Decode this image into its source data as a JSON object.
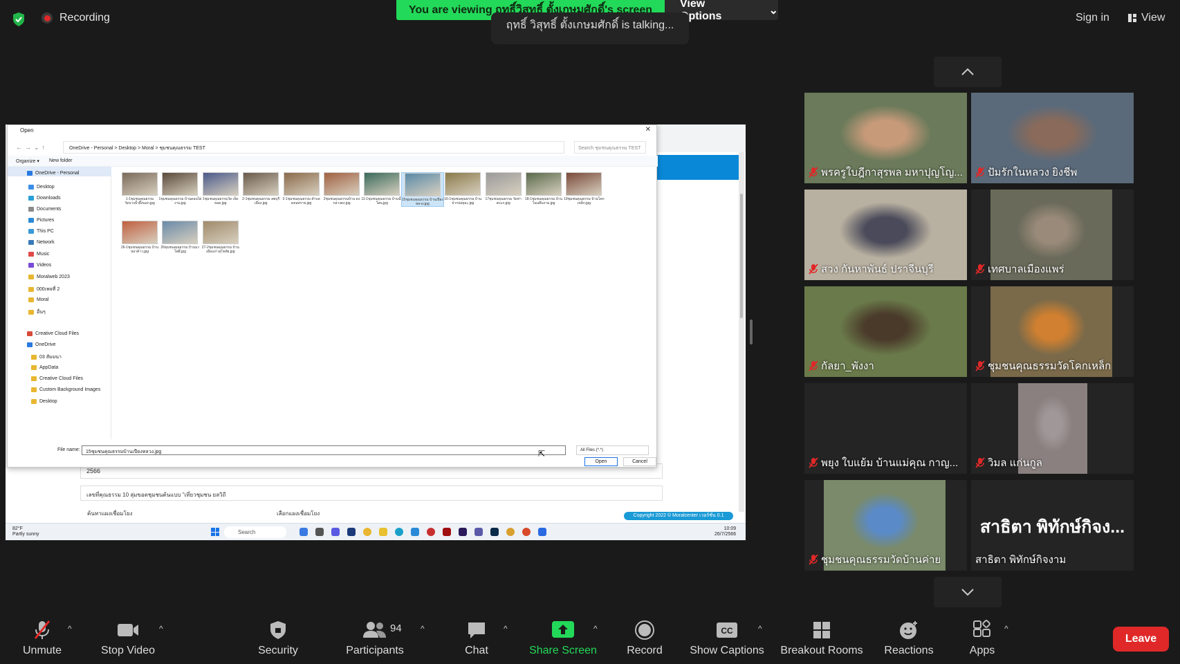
{
  "top": {
    "recording": "Recording",
    "viewing_banner": "You are viewing ฤทธิ์วิสุทธิ์ ตั้งเกษมศักดิ์'s screen",
    "view_options": "View Options",
    "talking": "ฤทธิ์ วิสุทธิ์ ตั้งเกษมศักดิ์ is talking...",
    "sign_in": "Sign in",
    "view": "View"
  },
  "dialog": {
    "title": "Open",
    "path": "OneDrive - Personal  >  Desktop  >  Moral  >  ชุมชนคุณธรรม TEST",
    "search_placeholder": "Search ชุมชนคุณธรรม TEST",
    "organize": "Organize ▾",
    "new_folder": "New folder",
    "nav": [
      {
        "label": "OneDrive - Personal",
        "color": "#2a7ae2"
      },
      {
        "label": "Desktop",
        "color": "#3a8ee6"
      },
      {
        "label": "Downloads",
        "color": "#2aa0d8"
      },
      {
        "label": "Documents",
        "color": "#8a8a8a"
      },
      {
        "label": "Pictures",
        "color": "#2a8ad8"
      },
      {
        "label": "This PC",
        "color": "#3a9ad8"
      },
      {
        "label": "Network",
        "color": "#3a7ab8"
      },
      {
        "label": "Music",
        "color": "#e04a4a"
      },
      {
        "label": "Videos",
        "color": "#7a4ad8"
      },
      {
        "label": "Moralweb 2023",
        "color": "#e8b630"
      },
      {
        "label": "000เพจที่ 2",
        "color": "#e8b630"
      },
      {
        "label": "Moral",
        "color": "#e8b630"
      },
      {
        "label": "อื่นๆ",
        "color": "#e8b630"
      },
      {
        "label": "Creative Cloud Files",
        "color": "#d84a3a"
      },
      {
        "label": "OneDrive",
        "color": "#2a7ae2"
      },
      {
        "label": "03 สัมมนา",
        "color": "#e8b630"
      },
      {
        "label": "AppData",
        "color": "#e8b630"
      },
      {
        "label": "Creative Cloud Files",
        "color": "#e8b630"
      },
      {
        "label": "Custom Background Images",
        "color": "#e8b630"
      },
      {
        "label": "Desktop",
        "color": "#e8b630"
      }
    ],
    "files": [
      {
        "caption": "1-1ชุมชนคุณธรรม วัดบางน้ำผึ้งนอก.jpg",
        "color": "#7a6a5a"
      },
      {
        "caption": "1ชุมชนคุณธรรม บ้านดอนไผ่งาม.jpg",
        "color": "#5a4a3a"
      },
      {
        "caption": "1ชุมชนคุณธรรมวัด เจ็ดยอด.jpg",
        "color": "#4a5a8a"
      },
      {
        "caption": "2-1ชุมชนคุณธรรม ลพบุรีเมือง.jpg",
        "color": "#6a5a4a"
      },
      {
        "caption": "2-1ชุมชนคุณธรรม ตำบลดอนทราย.jpg",
        "color": "#8a6a4a"
      },
      {
        "caption": "2ชุมชนคุณธรรมบ้าน ดงกลางดง.jpg",
        "color": "#a06040"
      },
      {
        "caption": "11-1ชุมชนคุณธรรม บ้านน้ำใสน.jpg",
        "color": "#3a6a5a"
      },
      {
        "caption": "15ชุมชนคุณธรรม บ้านเปียงหลวง.jpg",
        "color": "#5a8aa8"
      },
      {
        "caption": "16-1ชุมชนคุณธรรม บ้านปากบ่อยุมะ.jpg",
        "color": "#8a7a4a"
      },
      {
        "caption": "17ชุมชนคุณธรรม วัดท่าสะแก.jpg",
        "color": "#9a9a9a"
      },
      {
        "caption": "18-1ชุมชนคุณธรรม บ้านโนนคึมงาม.jpg",
        "color": "#5a6a4a"
      },
      {
        "caption": "19ชุมชนคุณธรรม บ้านโคกเหล็ก.jpg",
        "color": "#7a4a3a"
      },
      {
        "caption": "26-1ชุมชนคุณธรรม บ้านปลาค้าว.jpg",
        "color": "#c06040"
      },
      {
        "caption": "26ชุมชนคุณธรรม บ้านนาโพธิ์.jpg",
        "color": "#6a8aa8"
      },
      {
        "caption": "27-2ชุมชนคุณธรรม บ้านเมืองเก่าสุโขทัย.jpg",
        "color": "#a08a6a"
      }
    ],
    "file_name_label": "File name:",
    "file_name_value": "15ชุมชนคุณธรรมบ้านเปียงหลวง.jpg",
    "file_type": "All Files (*.*)",
    "open": "Open",
    "cancel": "Cancel"
  },
  "web": {
    "year": "2566",
    "description": "เลขที่คุณธรรม 10 ลุ่มขอดชุมชนต้นแบบ \"เที่ยวชุมชน ยลวิถี",
    "label1": "ค้นหาแผงเชื่อมโยง",
    "label2": "เลือกแผงเชื่อมโยง",
    "copyright": "Copyright 2022 © Moralcenter เวอร์ชั่น 0.1"
  },
  "taskbar": {
    "temp": "82°F",
    "weather": "Partly sunny",
    "search": "Search",
    "time": "10:09",
    "date": "26/7/2566"
  },
  "participants": [
    {
      "name": "พรครูใบฎีกาสุรพล มหาปุญโญ...",
      "bg": "#6a7a5a",
      "face": "#c79a7a"
    },
    {
      "name": "ปัมรักในหลวง ยิงชีพ",
      "bg": "#5a6a7a",
      "face": "#8a6a5a"
    },
    {
      "name": "สวง กันหาพันธ์ ปราจีนบุรี",
      "bg": "#b8b0a0",
      "face": "#4a4a5a"
    },
    {
      "name": "เทศบาลเมืองแพร่",
      "bg": "#6a6a5a",
      "face": "#9a8a7a"
    },
    {
      "name": "กัลยา_พังงา",
      "bg": "#6a7a4a",
      "face": "#4a3a2a"
    },
    {
      "name": "ชุมชนคุณธรรมวัดโคกเหล็ก",
      "bg": "#7a6a4a",
      "face": "#d08030"
    },
    {
      "name": "พยุง ใบแย้ม บ้านแม่คุณ กาญ...",
      "bg": "#242424",
      "face": "#242424"
    },
    {
      "name": "วิมล  แก่นกูล",
      "bg": "#8a8080",
      "face": "#a09898"
    },
    {
      "name": "ชุมชนคุณธรรมวัดบ้านค่าย",
      "bg": "#7a8a6a",
      "face": "#5a8ac8"
    },
    {
      "name": "สาธิตา พิทักษ์กิจงาม",
      "bg": "#242424",
      "face": "#242424",
      "big": "สาธิตา พิทักษ์กิจง..."
    }
  ],
  "toolbar": {
    "unmute": "Unmute",
    "stop_video": "Stop Video",
    "security": "Security",
    "participants": "Participants",
    "participant_count": "94",
    "chat": "Chat",
    "share_screen": "Share Screen",
    "record": "Record",
    "show_captions": "Show Captions",
    "breakout_rooms": "Breakout Rooms",
    "reactions": "Reactions",
    "apps": "Apps",
    "leave": "Leave"
  },
  "colors": {
    "share_green": "#23d959",
    "leave_red": "#e02828",
    "mute_red": "#e02828"
  }
}
